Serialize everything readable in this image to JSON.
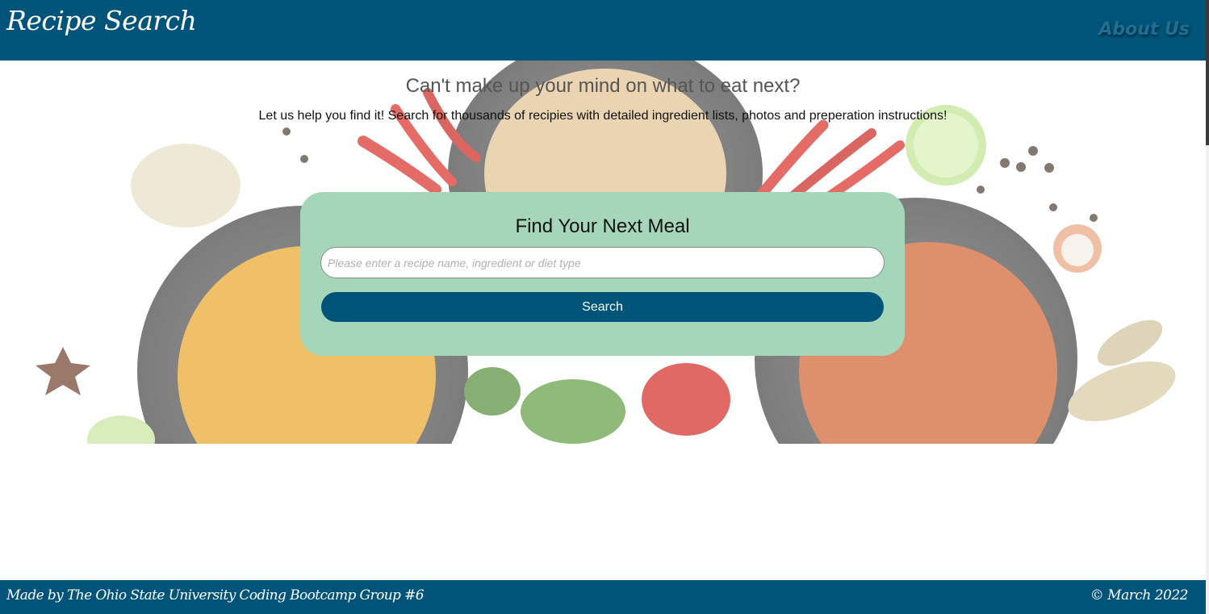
{
  "header": {
    "brand": "Recipe Search",
    "nav_about": "About Us"
  },
  "hero": {
    "tagline": "Can't make up your mind on what to eat next?",
    "subtext": "Let us help you find it! Search for thousands of recipies with detailed ingredient lists, photos and preperation instructions!"
  },
  "search": {
    "title": "Find Your Next Meal",
    "placeholder": "Please enter a recipe name, ingredient or diet type",
    "button_label": "Search"
  },
  "footer": {
    "credit": "Made by The Ohio State University Coding Bootcamp Group #6",
    "copyright": "© March 2022"
  },
  "colors": {
    "header_bg": "#005479",
    "card_bg": "#a6d6b9",
    "button_bg": "#005479"
  }
}
